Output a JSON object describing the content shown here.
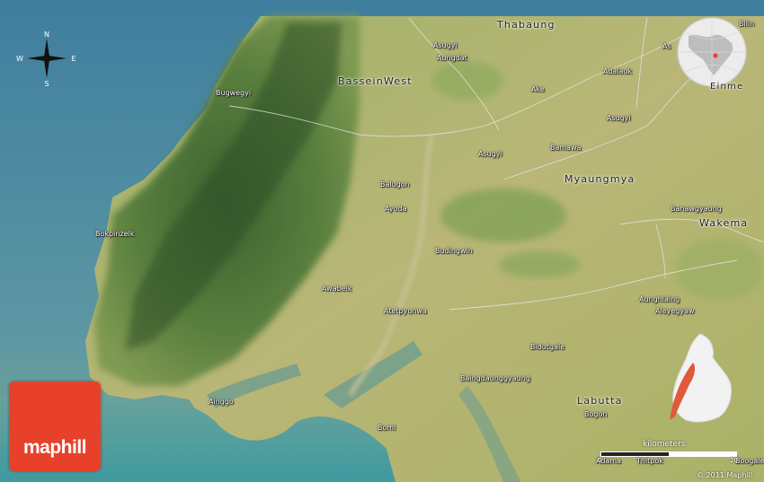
{
  "brand": {
    "name": "maphill",
    "color": "#e8412b"
  },
  "compass": {
    "north": "N",
    "south": "S",
    "west": "W",
    "east": "E"
  },
  "scale": {
    "unit": "kilometers",
    "min": "0",
    "max": "20"
  },
  "copyright": "© 2011 Maphill",
  "overlays": {
    "globe": "globe-locator-icon",
    "inset": "region-locator-map",
    "compass": "compass-rose-icon"
  },
  "regions": {
    "bassein_west": "BasseinWest",
    "thabaung": "Thabaung",
    "myaungmya": "Myaungmya",
    "wakema": "Wakema",
    "labutta": "Labutta",
    "einme": "Einme"
  },
  "places": {
    "bilin": "Bilin",
    "asugyi_n": "Asugyi",
    "aungdat": "Aungdat",
    "as_ne": "As",
    "bugwegyi": "Bugwegyi",
    "adalauk": "Adalauk",
    "ake": "Ake",
    "asugyi_e": "Asugyi",
    "bamawa": "Bamawa",
    "asugyi_c": "Asugyi",
    "balugon": "Balugon",
    "ayoda": "Ayoda",
    "banawgyaung": "Banawgyaung",
    "bokpinzeik": "Bokpinzeik",
    "budingwin": "Budingwin",
    "awabeik": "Awabeik",
    "aunghlaing": "Aunghlaing",
    "atetpyunwa": "Atetpyunwa",
    "aleyegyaw": "Aleyegyaw",
    "bidutgale": "Bidutgale",
    "baingdaung": "Baingdaunggyaung",
    "ainggo": "Ainggo",
    "bogon": "Bogon",
    "bomi": "Bomi",
    "adama": "Adama",
    "thitpok": "Thitpok",
    "boogale": "Boogale"
  }
}
